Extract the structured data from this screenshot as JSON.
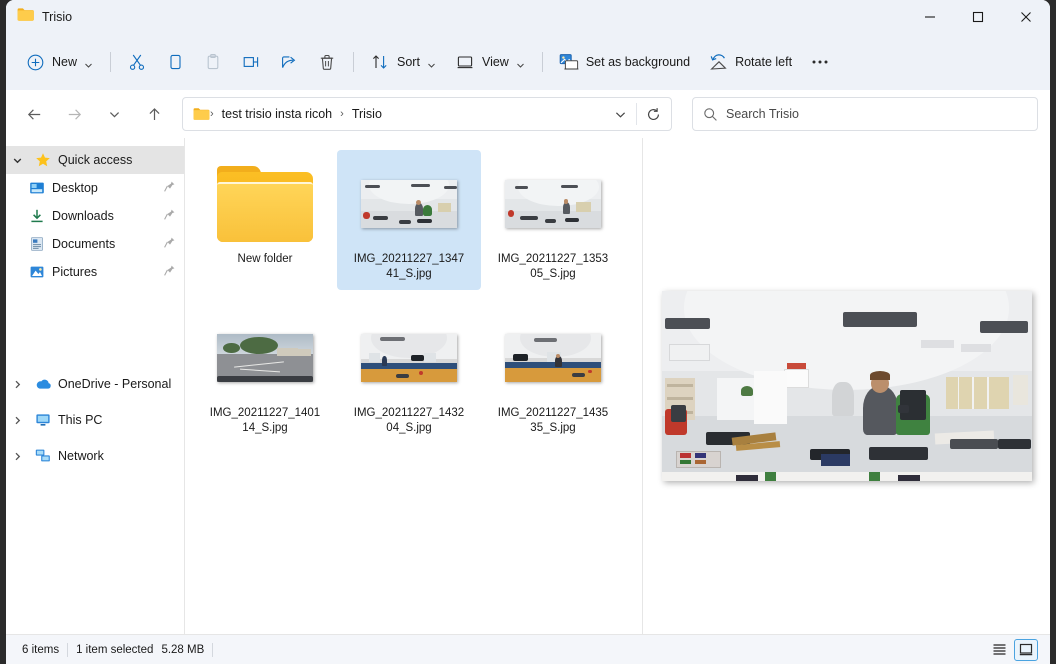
{
  "window": {
    "title": "Trisio",
    "folder_icon": "folder-icon",
    "controls": {
      "minimize": "minimize-icon",
      "maximize": "maximize-icon",
      "close": "close-icon"
    }
  },
  "toolbar": {
    "new_label": "New",
    "cut_label": "Cut",
    "copy_label": "Copy",
    "paste_label": "Paste",
    "rename_label": "Rename",
    "share_label": "Share",
    "delete_label": "Delete",
    "sort_label": "Sort",
    "view_label": "View",
    "set_as_background_label": "Set as background",
    "rotate_left_label": "Rotate left",
    "more_label": "See more"
  },
  "addressbar": {
    "back": "back-icon",
    "forward": "forward-icon",
    "recent": "recent-locations-icon",
    "up": "up-icon",
    "crumbs": [
      "test trisio insta ricoh",
      "Trisio"
    ],
    "separator": "›",
    "dropdown": "previous-locations-icon",
    "refresh": "refresh-icon"
  },
  "search": {
    "placeholder": "Search Trisio",
    "value": ""
  },
  "sidebar": {
    "items": [
      {
        "label": "Quick access",
        "icon": "star-icon",
        "expander": "chevron-down-icon",
        "selected": true,
        "pinned": false,
        "child": false
      },
      {
        "label": "Desktop",
        "icon": "desktop-icon",
        "expander": "",
        "selected": false,
        "pinned": true,
        "child": true
      },
      {
        "label": "Downloads",
        "icon": "downloads-icon",
        "expander": "",
        "selected": false,
        "pinned": true,
        "child": true
      },
      {
        "label": "Documents",
        "icon": "documents-icon",
        "expander": "",
        "selected": false,
        "pinned": true,
        "child": true
      },
      {
        "label": "Pictures",
        "icon": "pictures-icon",
        "expander": "",
        "selected": false,
        "pinned": true,
        "child": true
      },
      {
        "label": "OneDrive - Personal",
        "icon": "onedrive-icon",
        "expander": "chevron-right-icon",
        "selected": false,
        "pinned": false,
        "child": false
      },
      {
        "label": "This PC",
        "icon": "this-pc-icon",
        "expander": "chevron-right-icon",
        "selected": false,
        "pinned": false,
        "child": false
      },
      {
        "label": "Network",
        "icon": "network-icon",
        "expander": "chevron-right-icon",
        "selected": false,
        "pinned": false,
        "child": false
      }
    ]
  },
  "files": [
    {
      "name": "New folder",
      "kind": "folder",
      "selected": false,
      "scene": "folder"
    },
    {
      "name": "IMG_20211227_134741_S.jpg",
      "kind": "image",
      "selected": true,
      "scene": "office"
    },
    {
      "name": "IMG_20211227_135305_S.jpg",
      "kind": "image",
      "selected": false,
      "scene": "office"
    },
    {
      "name": "IMG_20211227_140114_S.jpg",
      "kind": "image",
      "selected": false,
      "scene": "street"
    },
    {
      "name": "IMG_20211227_143204_S.jpg",
      "kind": "image",
      "selected": false,
      "scene": "room"
    },
    {
      "name": "IMG_20211227_143535_S.jpg",
      "kind": "image",
      "selected": false,
      "scene": "room2"
    }
  ],
  "preview": {
    "scene": "office",
    "alt": "360 degree equirectangular office photo preview"
  },
  "statusbar": {
    "item_count": "6 items",
    "selection": "1 item selected",
    "size": "5.28 MB",
    "details_view": "details-view-icon",
    "large_icons_view": "large-icons-view-icon",
    "active_view": "large-icons-view-icon"
  },
  "colors": {
    "titlebar": "#eef2f8",
    "selection": "#cfe4f7",
    "accent": "#0f6cbd",
    "view_active_border": "#4aa3e0",
    "folder": "#f6bb2a"
  }
}
